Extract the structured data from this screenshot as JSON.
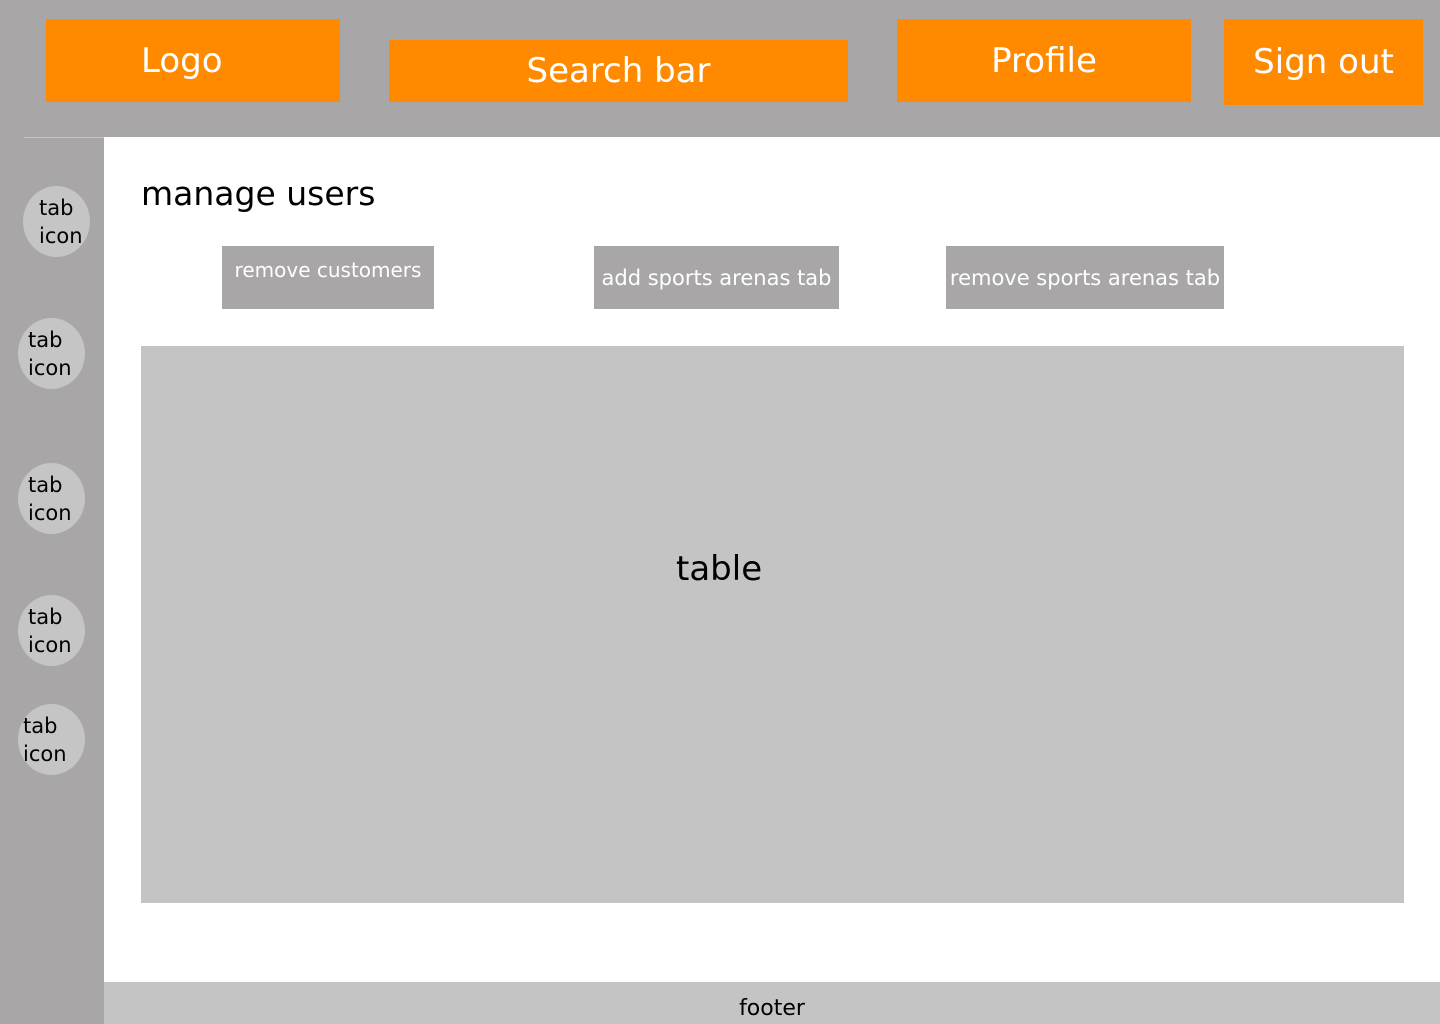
{
  "header": {
    "logo_label": "Logo",
    "search_label": "Search bar",
    "profile_label": "Profile",
    "signout_label": "Sign out"
  },
  "sidebar": {
    "items": [
      {
        "line1": "tab",
        "line2": "icon"
      },
      {
        "line1": "tab",
        "line2": "icon"
      },
      {
        "line1": "tab",
        "line2": "icon"
      },
      {
        "line1": "tab",
        "line2": "icon"
      },
      {
        "line1": "tab",
        "line2": "icon"
      }
    ]
  },
  "main": {
    "title": "manage users",
    "actions": {
      "remove_customers": "remove customers",
      "add_sports_arenas": "add sports arenas tab",
      "remove_sports_arenas": "remove sports arenas tab"
    },
    "table_label": "table"
  },
  "footer": {
    "label": "footer"
  },
  "colors": {
    "accent": "#ff8a00",
    "chrome_gray": "#a8a6a7",
    "panel_gray": "#c4c4c4"
  }
}
